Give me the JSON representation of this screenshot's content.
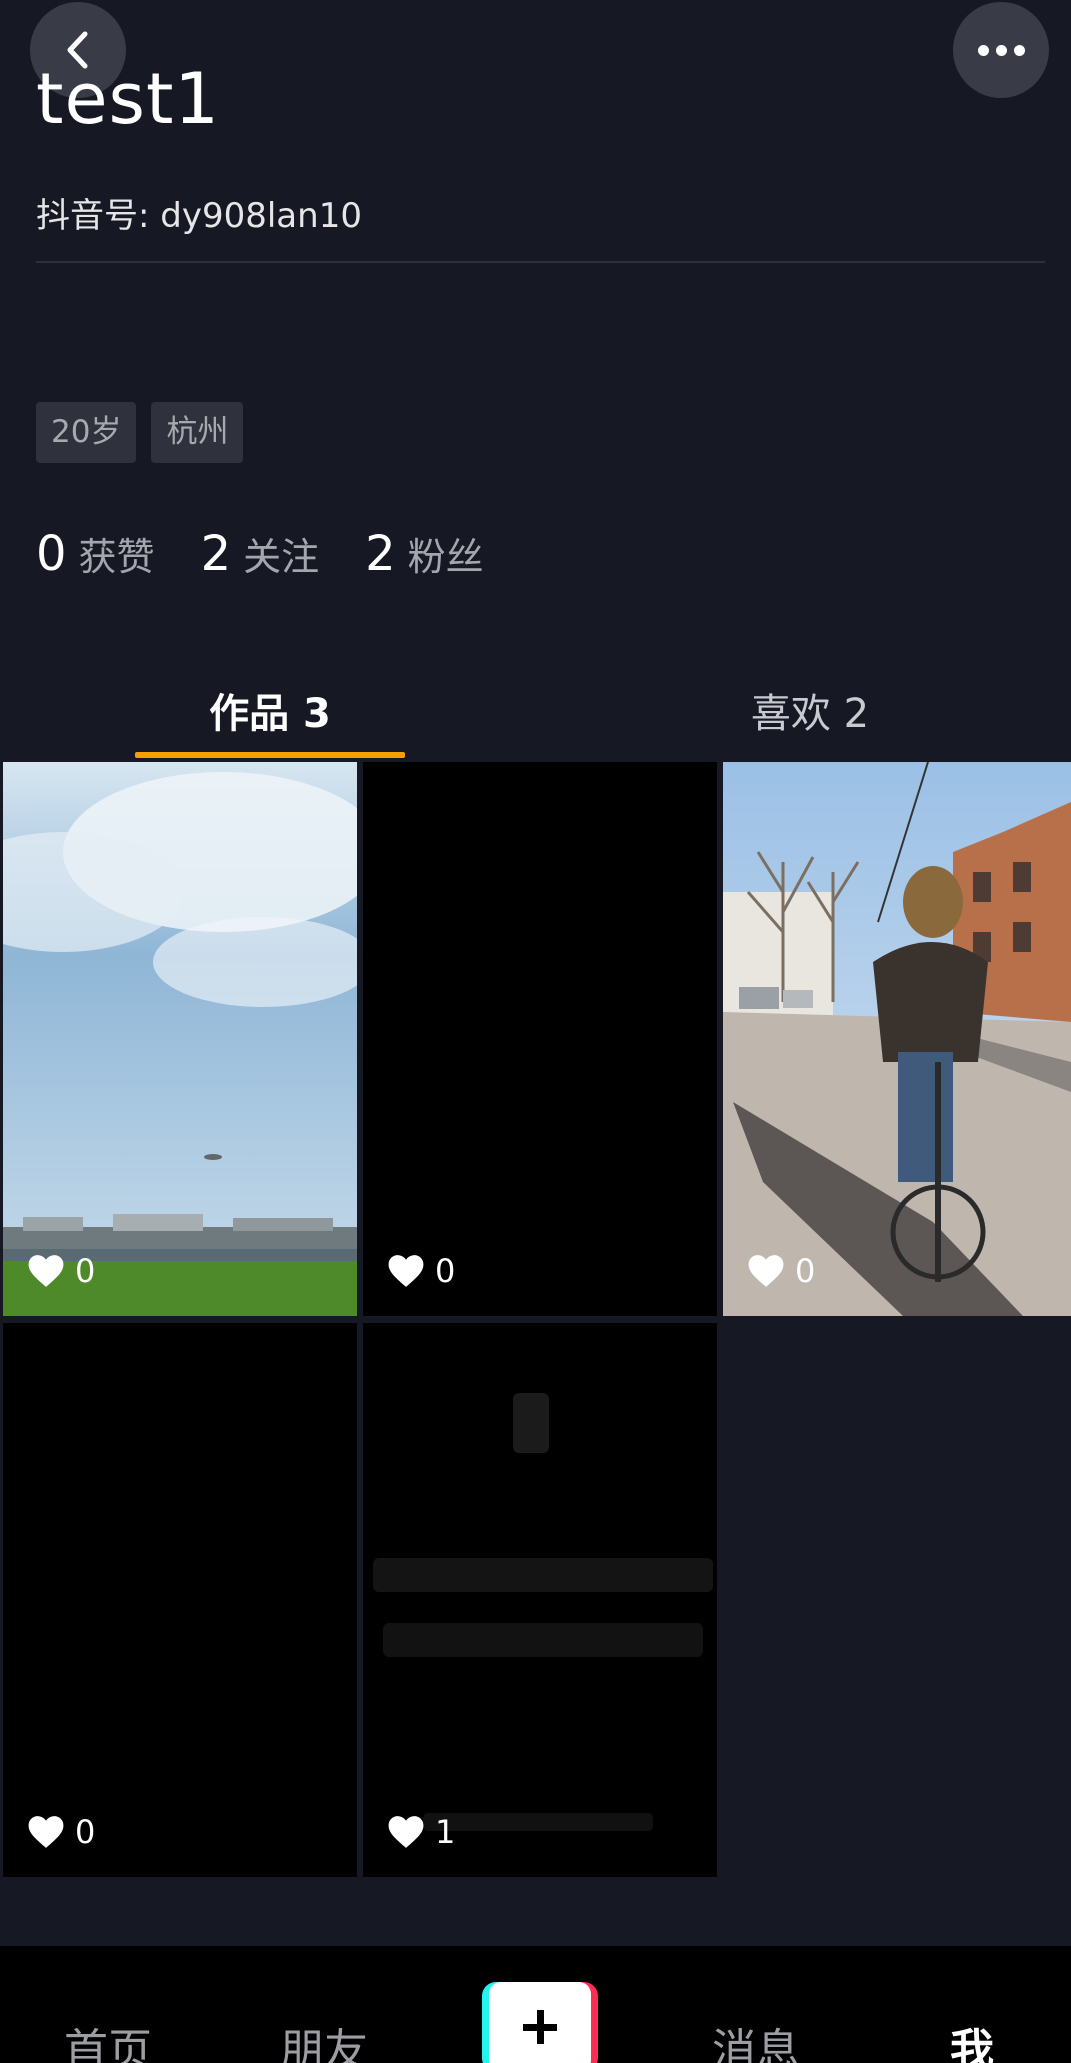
{
  "header": {
    "username": "test1",
    "douyin_id": "抖音号: dy908lan10"
  },
  "tags": [
    "20岁",
    "杭州"
  ],
  "stats": [
    {
      "num": "0",
      "label": "获赞"
    },
    {
      "num": "2",
      "label": "关注"
    },
    {
      "num": "2",
      "label": "粉丝"
    }
  ],
  "tabs": {
    "works": "作品 3",
    "likes": "喜欢 2"
  },
  "videos": [
    {
      "likes": "0"
    },
    {
      "likes": "0"
    },
    {
      "likes": "0"
    },
    {
      "likes": "0"
    },
    {
      "likes": "1"
    }
  ],
  "nav": {
    "home": "首页",
    "friends": "朋友",
    "messages": "消息",
    "me": "我"
  },
  "colors": {
    "background": "#161823",
    "tab_underline": "#f5a000",
    "plus_cyan": "#25f4ee",
    "plus_red": "#fe2c55"
  },
  "icons": [
    "back-arrow-icon",
    "more-dots-icon",
    "heart-icon",
    "plus-icon"
  ]
}
